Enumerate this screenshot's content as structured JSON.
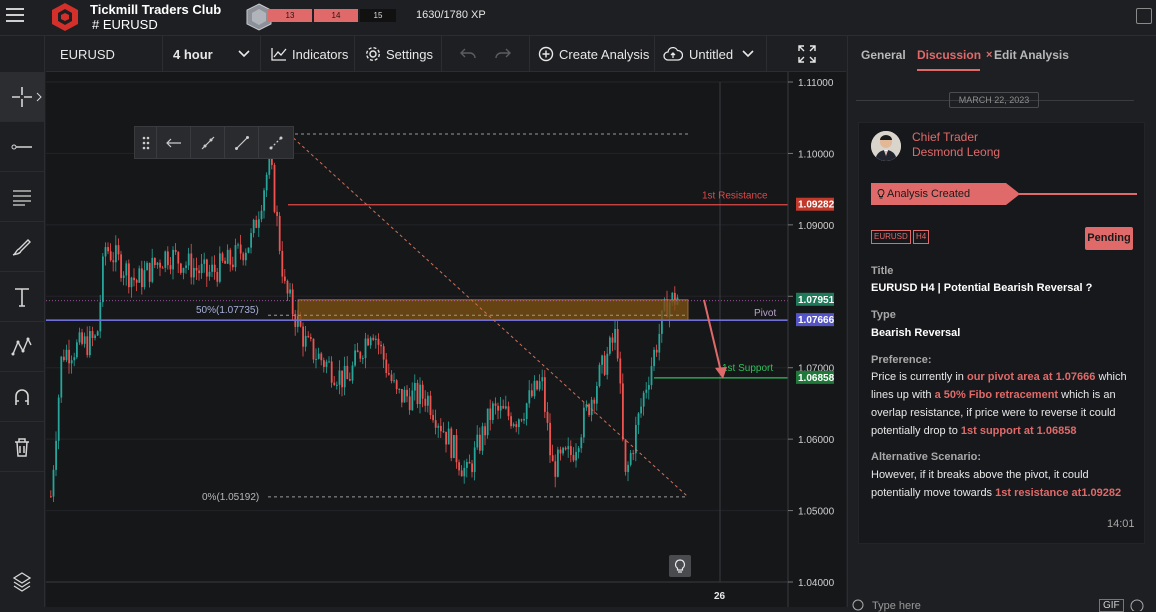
{
  "header": {
    "club_title": "Tickmill Traders Club",
    "channel": "# EURUSD",
    "xp_segments": [
      "13",
      "14",
      "15"
    ],
    "xp_text": "1630/1780 XP"
  },
  "sidebar": {
    "tools": [
      "crosshair-icon",
      "line-tool-icon",
      "fib-tool-icon",
      "brush-icon",
      "text-icon",
      "pattern-icon",
      "magnet-icon",
      "trash-icon",
      "layers-icon"
    ]
  },
  "toolbar": {
    "symbol": "EURUSD",
    "timeframe": "4 hour",
    "indicators": "Indicators",
    "settings": "Settings",
    "create_analysis": "Create Analysis",
    "layout_name": "Untitled"
  },
  "chart": {
    "price_ticks": [
      "1.11000",
      "1.10000",
      "1.09000",
      "1.08000",
      "1.07000",
      "1.06000",
      "1.05000",
      "1.04000"
    ],
    "date_tick": "26",
    "annotations": {
      "resistance": "1st Resistance",
      "pivot": "Pivot",
      "support": "1st Support",
      "fib50": "50%(1.07735)",
      "fib0": "0%(1.05192)"
    },
    "price_labels": {
      "resistance": "1.09282",
      "pivot_top": "1.07951",
      "pivot_bottom": "1.07666",
      "support": "1.06858"
    },
    "colors": {
      "resistance": "#e04848",
      "support": "#2fbf5a",
      "pivot_zone": "#7a4f12",
      "pivot_bottom": "#6f6fd6",
      "bull": "#26a69a",
      "bear": "#ef5350"
    }
  },
  "panel": {
    "tabs": [
      "General",
      "Discussion",
      "Edit Analysis"
    ],
    "active_tab": "Discussion",
    "date": "MARCH 22, 2023",
    "author_role": "Chief Trader",
    "author_name": "Desmond Leong",
    "status_banner": "Analysis Created",
    "tags": [
      "EURUSD",
      "H4"
    ],
    "status": "Pending",
    "title_label": "Title",
    "title_value": "EURUSD H4 | Potential Bearish Reversal ?",
    "type_label": "Type",
    "type_value": "Bearish Reversal",
    "preference_label": "Preference:",
    "preference_parts": [
      "Price is currently in ",
      "our pivot area at 1.07666",
      " which lines up with ",
      "a 50% Fibo retracement",
      " which is an overlap resistance, if price were to reverse it could potentially drop to ",
      "1st support at 1.06858"
    ],
    "alt_label": "Alternative Scenario:",
    "alt_parts": [
      "However, if it breaks above the pivot, it could potentially move towards ",
      "1st resistance at1.09282"
    ],
    "time": "14:01",
    "input_placeholder": "Type here",
    "gif_label": "GIF"
  }
}
